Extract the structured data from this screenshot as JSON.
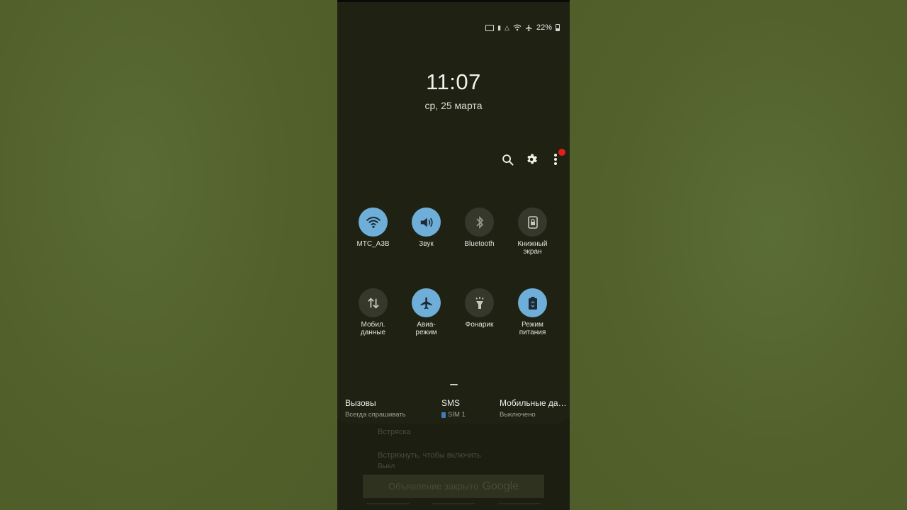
{
  "status_bar": {
    "battery_percent": "22%",
    "icons": [
      "cast-icon",
      "sd-card-icon",
      "sync-icon",
      "wifi-icon",
      "airplane-icon",
      "battery-icon"
    ]
  },
  "clock": {
    "time": "11:07",
    "date": "ср, 25 марта"
  },
  "top_actions": {
    "icons": [
      "search-icon",
      "settings-icon",
      "more-options-icon"
    ],
    "has_notification_badge": true
  },
  "quick_settings": {
    "accent_on": "#6eaed8",
    "rows": [
      [
        {
          "label": "МТС_A3B",
          "icon": "wifi-icon",
          "on": true
        },
        {
          "label": "Звук",
          "icon": "sound-icon",
          "on": true
        },
        {
          "label": "Bluetooth",
          "icon": "bluetooth-icon",
          "on": false
        },
        {
          "label": "Книжный\nэкран",
          "icon": "portrait-lock-icon",
          "on": false
        }
      ],
      [
        {
          "label": "Мобил.\nданные",
          "icon": "mobile-data-icon",
          "on": false
        },
        {
          "label": "Авиа-\nрежим",
          "icon": "airplane-icon",
          "on": true
        },
        {
          "label": "Фонарик",
          "icon": "flashlight-icon",
          "on": false
        },
        {
          "label": "Режим\nпитания",
          "icon": "power-mode-icon",
          "on": true
        }
      ]
    ]
  },
  "sim_settings": {
    "calls": {
      "title": "Вызовы",
      "value": "Всегда спрашивать"
    },
    "sms": {
      "title": "SMS",
      "value": "SIM 1"
    },
    "mobile_data": {
      "title": "Мобильные да…",
      "value": "Выключено"
    }
  },
  "background": {
    "vibration_label": "Встряска",
    "shake_label": "Встряхнуть, чтобы включить",
    "shake_value": "Выкл",
    "ad_text": "Объявление закрыто",
    "ad_brand": "Google"
  }
}
